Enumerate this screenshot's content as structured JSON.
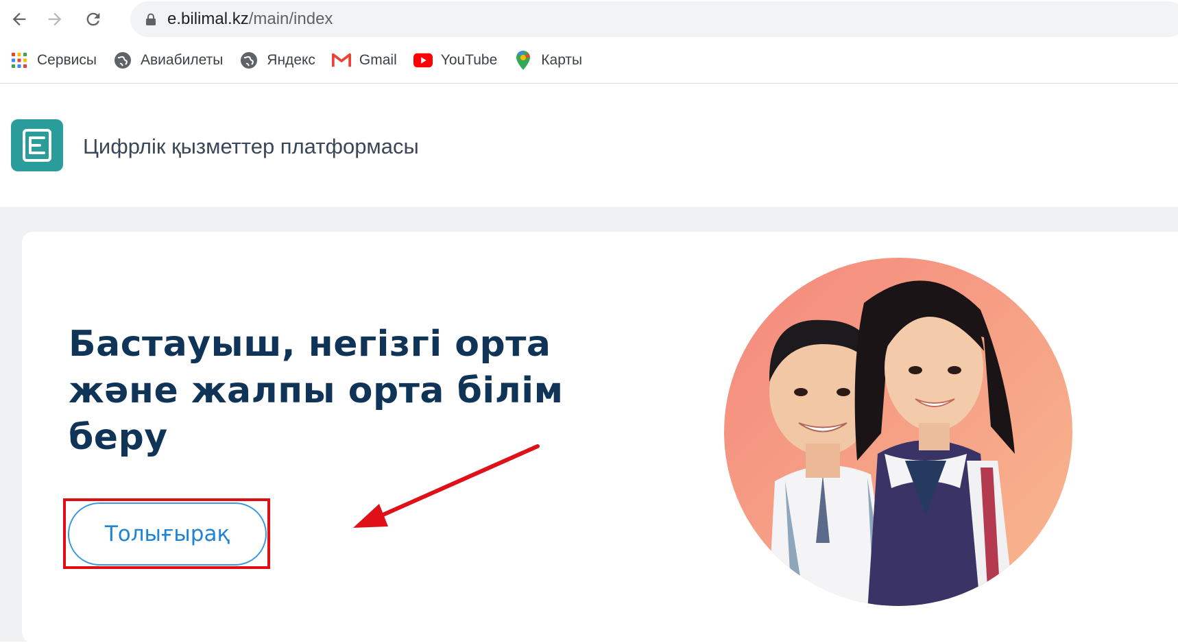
{
  "browser": {
    "url_host": "e.bilimal.kz",
    "url_path": "/main/index",
    "bookmarks": [
      {
        "label": "Сервисы",
        "icon": "apps-grid-icon"
      },
      {
        "label": "Авиабилеты",
        "icon": "globe-icon"
      },
      {
        "label": "Яндекс",
        "icon": "globe-icon"
      },
      {
        "label": "Gmail",
        "icon": "gmail-icon"
      },
      {
        "label": "YouTube",
        "icon": "youtube-icon"
      },
      {
        "label": "Карты",
        "icon": "maps-pin-icon"
      }
    ]
  },
  "site": {
    "title": "Цифрлік қызметтер платформасы",
    "logo_color": "#2a9d9a"
  },
  "hero": {
    "title": "Бастауыш, негізгі орта және жалпы орта білім беру",
    "button_label": "Толығырақ",
    "title_color": "#0f3458",
    "button_color": "#1f84d6"
  },
  "annotation": {
    "highlight_color": "#e00d13"
  }
}
